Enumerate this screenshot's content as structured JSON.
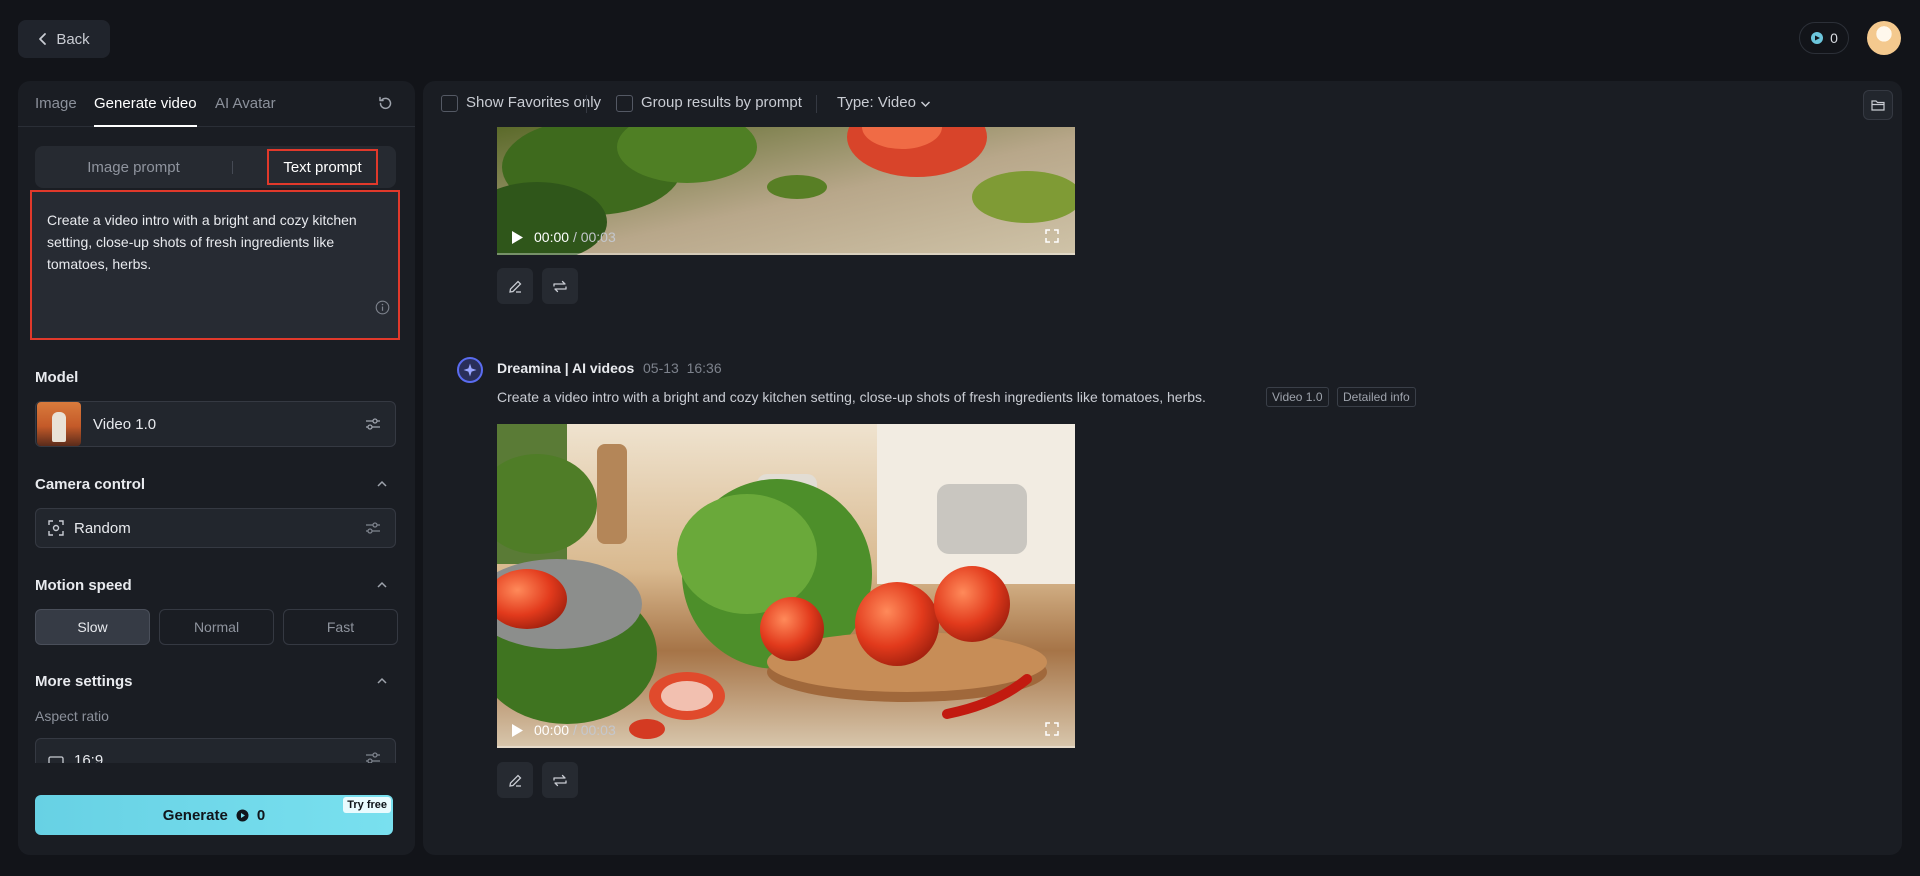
{
  "header": {
    "back_label": "Back",
    "credits": "0"
  },
  "left_panel": {
    "tabs": [
      {
        "label": "Image"
      },
      {
        "label": "Generate video"
      },
      {
        "label": "AI Avatar"
      }
    ],
    "prompt_modes": [
      {
        "label": "Image prompt"
      },
      {
        "label": "Text prompt"
      }
    ],
    "prompt_text": "Create a video intro with a bright and cozy kitchen setting, close-up shots of fresh ingredients like tomatoes, herbs.",
    "model": {
      "label": "Model",
      "value": "Video 1.0"
    },
    "camera_control": {
      "label": "Camera control",
      "value": "Random"
    },
    "motion_speed": {
      "label": "Motion speed",
      "options": [
        {
          "label": "Slow"
        },
        {
          "label": "Normal"
        },
        {
          "label": "Fast"
        }
      ],
      "selected": "Slow"
    },
    "more_settings": {
      "label": "More settings",
      "aspect_ratio_label": "Aspect ratio",
      "aspect_ratio_value": "16:9"
    },
    "generate": {
      "label": "Generate",
      "cost": "0",
      "badge": "Try free"
    }
  },
  "main": {
    "filters": {
      "favorites_label": "Show Favorites only",
      "group_label": "Group results by prompt",
      "type_label": "Type: Video"
    },
    "results": [
      {
        "time_current": "00:00",
        "time_total": "/ 00:03"
      },
      {
        "author": "Dreamina | AI videos",
        "date": "05-13",
        "time": "16:36",
        "prompt": "Create a video intro with a bright and cozy kitchen setting, close-up shots of fresh ingredients like tomatoes, herbs.",
        "tags": [
          "Video 1.0",
          "Detailed info"
        ],
        "time_current": "00:00",
        "time_total": "/ 00:03"
      }
    ]
  },
  "colors": {
    "accent_generate": "#67d1e4",
    "highlight_red": "#e1392b",
    "background": "#121419",
    "panel": "#1a1d23"
  }
}
